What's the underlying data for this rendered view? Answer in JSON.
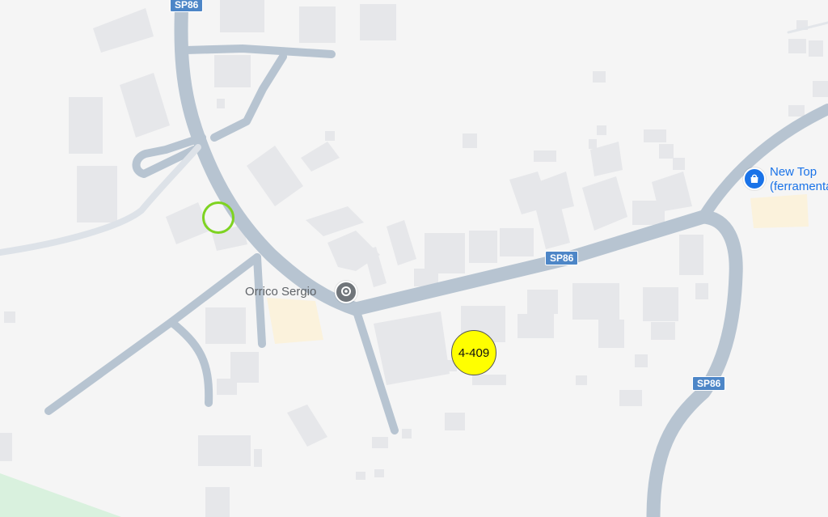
{
  "map": {
    "road_labels": [
      {
        "id": "top",
        "text": "SP86"
      },
      {
        "id": "mid",
        "text": "SP86"
      },
      {
        "id": "right",
        "text": "SP86"
      }
    ],
    "places": {
      "sergio": {
        "name": "Orrico Sergio",
        "icon": "place-pin-icon"
      },
      "newtop": {
        "name_line1": "New Top",
        "name_line2": "(ferramenta)",
        "icon": "shopping-bag-icon"
      }
    },
    "marker": {
      "label": "4-409"
    },
    "selection": {
      "icon": "selection-ring"
    }
  },
  "colors": {
    "background": "#f5f5f5",
    "road": "#b7c4d1",
    "building": "#e6e7ea",
    "park": "#d9f1de",
    "sand": "#fbf2dc",
    "road_badge": "#4d86c7",
    "place_text_grey": "#5f6368",
    "place_text_blue": "#1a73e8",
    "pin_grey": "#70757a",
    "pin_blue": "#1a73e8",
    "marker_fill": "#ffff00",
    "ring_color": "#7ed321"
  }
}
